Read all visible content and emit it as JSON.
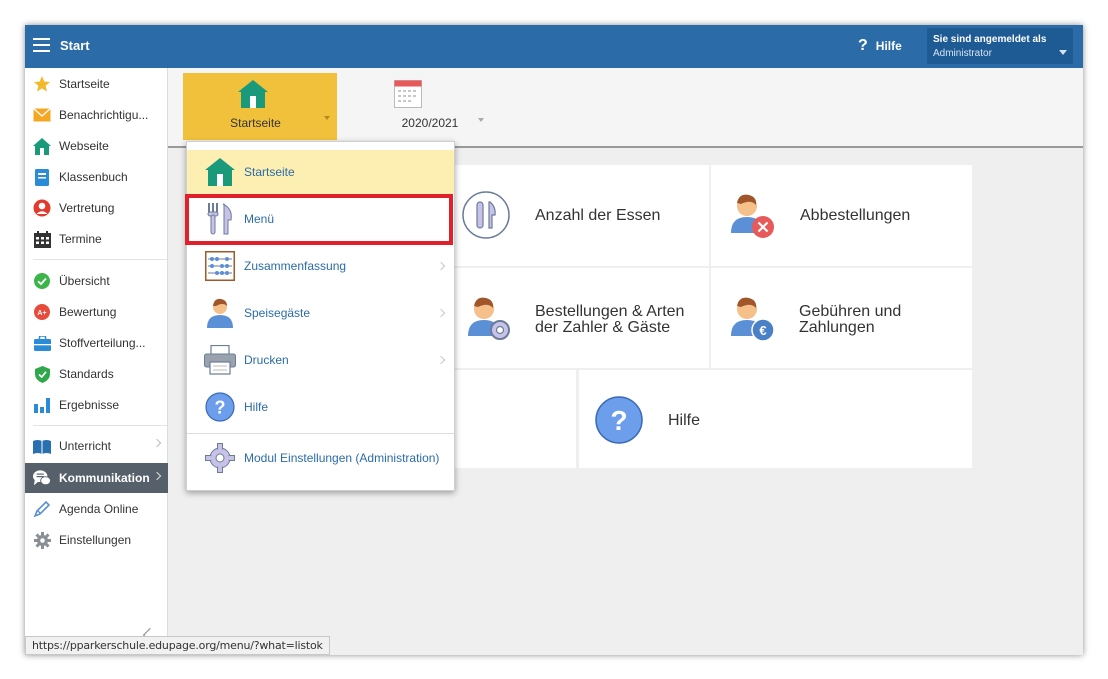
{
  "topbar": {
    "title": "Start",
    "help_label": "Hilfe",
    "user_line1": "Sie sind angemeldet als",
    "user_line2": "Administrator"
  },
  "sidebar": {
    "items": [
      {
        "label": "Startseite",
        "icon": "star-icon"
      },
      {
        "label": "Benachrichtigu...",
        "icon": "envelope-icon"
      },
      {
        "label": "Webseite",
        "icon": "house-icon"
      },
      {
        "label": "Klassenbuch",
        "icon": "book-icon"
      },
      {
        "label": "Vertretung",
        "icon": "substitute-icon"
      },
      {
        "label": "Termine",
        "icon": "calendar-icon"
      },
      {
        "label": "Übersicht",
        "icon": "check-circle-icon"
      },
      {
        "label": "Bewertung",
        "icon": "grade-icon"
      },
      {
        "label": "Stoffverteilung...",
        "icon": "briefcase-icon"
      },
      {
        "label": "Standards",
        "icon": "shield-icon"
      },
      {
        "label": "Ergebnisse",
        "icon": "bar-chart-icon"
      },
      {
        "label": "Unterricht",
        "icon": "open-book-icon"
      },
      {
        "label": "Kommunikation",
        "icon": "chat-icon"
      },
      {
        "label": "Agenda Online",
        "icon": "pen-icon"
      },
      {
        "label": "Einstellungen",
        "icon": "gear-icon"
      }
    ]
  },
  "toolbar": {
    "start_label": "Startseite",
    "year_label": "2020/2021"
  },
  "tiles": {
    "anzahl": "Anzahl der Essen",
    "abbestellungen": "Abbestellungen",
    "bestellungen_line1": "Bestellungen & Arten",
    "bestellungen_line2": "der Zahler & Gäste",
    "gebuehren_line1": "Gebühren und",
    "gebuehren_line2": "Zahlungen",
    "hilfe": "Hilfe"
  },
  "dropdown": {
    "items": [
      {
        "label": "Startseite",
        "icon": "house-icon"
      },
      {
        "label": "Menü",
        "icon": "cutlery-icon"
      },
      {
        "label": "Zusammenfassung",
        "icon": "abacus-icon"
      },
      {
        "label": "Speisegäste",
        "icon": "person-icon"
      },
      {
        "label": "Drucken",
        "icon": "printer-icon"
      },
      {
        "label": "Hilfe",
        "icon": "help-icon"
      },
      {
        "label": "Modul Einstellungen (Administration)",
        "icon": "gear-icon"
      }
    ]
  },
  "status_url": "https://pparkerschule.edupage.org/menu/?what=listok",
  "colors": {
    "topbar": "#2b6ca8",
    "accent_yellow": "#f2c13c",
    "highlight_red": "#e0202a",
    "link_blue": "#2b6ca8"
  }
}
